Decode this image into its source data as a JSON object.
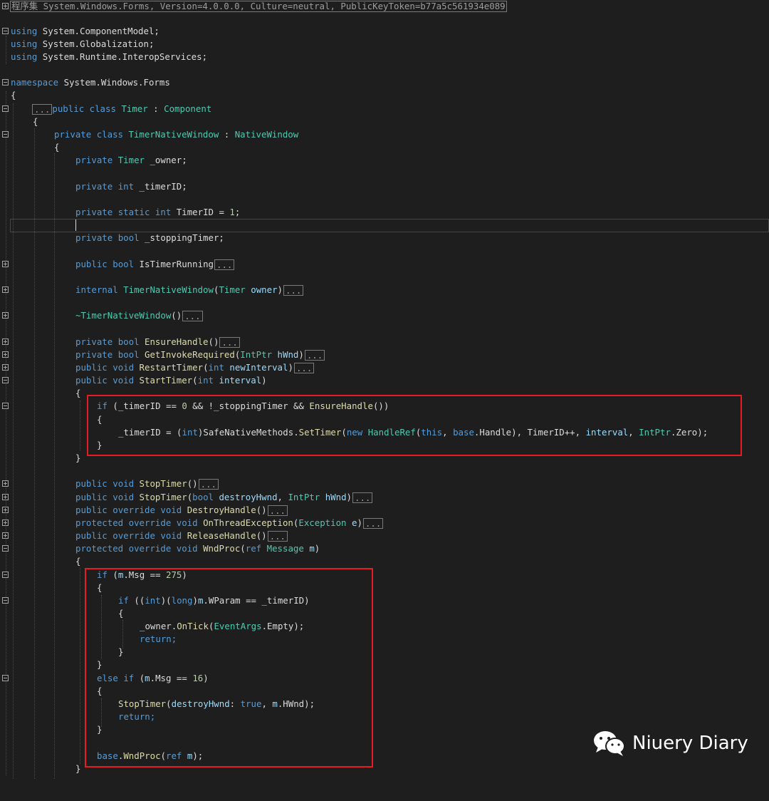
{
  "header": {
    "assembly_label": "程序集 System.Windows.Forms, Version=4.0.0.0, Culture=neutral, PublicKeyToken=b77a5c561934e089"
  },
  "collapsed_marker": "...",
  "code": {
    "using_1": "System.ComponentModel;",
    "using_2": "System.Globalization;",
    "using_3": "System.Runtime.InteropServices;",
    "namespace_name": "System.Windows.Forms",
    "class_timer": "Timer",
    "class_component": "Component",
    "class_native_window_name": "TimerNativeWindow",
    "class_native_window_base": "NativeWindow",
    "field_owner": "_owner;",
    "field_timer_id": "_timerID;",
    "field_static_timer_id": "TimerID = ",
    "field_static_value": "1",
    "field_stopping": "_stoppingTimer;",
    "prop_is_running": "IsTimerRunning",
    "ctor_name": "TimerNativeWindow",
    "ctor_param": "owner",
    "dtor_name": "~TimerNativeWindow",
    "m_ensure": "EnsureHandle",
    "m_invoke": "GetInvokeRequired",
    "m_invoke_param_type": "IntPtr",
    "m_invoke_param": "hWnd",
    "m_restart": "RestartTimer",
    "m_restart_param": "newInterval",
    "m_start": "StartTimer",
    "m_start_param": "interval",
    "if1_cond_a": "(_timerID == ",
    "if1_cond_b": "0",
    "if1_cond_c": " && !_stoppingTimer && ",
    "if1_cond_d": "EnsureHandle",
    "if1_cond_e": "())",
    "set_a": "_timerID = (",
    "set_b": ")SafeNativeMethods.",
    "set_c": "SetTimer",
    "set_d": "HandleRef",
    "set_e": ".Handle), TimerID++, ",
    "set_f": "interval",
    "set_g": "IntPtr",
    "set_h": ".Zero);",
    "m_stop": "StopTimer",
    "m_stop_param1": "destroyHwnd",
    "m_stop_param2": "hWnd",
    "m_destroy": "DestroyHandle",
    "m_thread_ex": "OnThreadException",
    "m_thread_ex_type": "Exception",
    "m_thread_ex_param": "e",
    "m_release": "ReleaseHandle",
    "m_wndproc": "WndProc",
    "m_wndproc_type": "Message",
    "m_wndproc_param": "m",
    "if2_a": "m",
    "if2_b": ".Msg == ",
    "if2_c": "275",
    "if3_a": "((",
    "if3_b": ")(",
    "if3_c": ")",
    "if3_d": "m",
    "if3_e": ".WParam == _timerID)",
    "tick_a": "_owner.",
    "tick_b": "OnTick",
    "tick_c": "EventArgs",
    "tick_d": ".Empty);",
    "elif_a": "m",
    "elif_b": ".Msg == ",
    "elif_c": "16",
    "stop_call_a": "StopTimer",
    "stop_call_b": "destroyHwnd",
    "stop_call_c": ": ",
    "stop_call_d": "true",
    "stop_call_e": ", ",
    "stop_call_f": "m",
    "stop_call_g": ".HWnd);",
    "base_a": ".",
    "base_b": "WndProc",
    "base_c": "m"
  },
  "keywords": {
    "using": "using",
    "namespace": "namespace",
    "public": "public",
    "private": "private",
    "internal": "internal",
    "protected": "protected",
    "override": "override",
    "class": "class",
    "static": "static",
    "int": "int",
    "bool": "bool",
    "long": "long",
    "void": "void",
    "if": "if",
    "else": "else",
    "new": "new",
    "this": "this",
    "base": "base",
    "ref": "ref",
    "return": "return;"
  },
  "watermark": {
    "text": "Niuery Diary",
    "icon": "wechat-icon"
  },
  "colors": {
    "background": "#1e1e1e",
    "keyword": "#569cd6",
    "type": "#4ec9b0",
    "parameter": "#9cdcfe",
    "number": "#b5cea8",
    "highlight_box": "#e51c23"
  }
}
